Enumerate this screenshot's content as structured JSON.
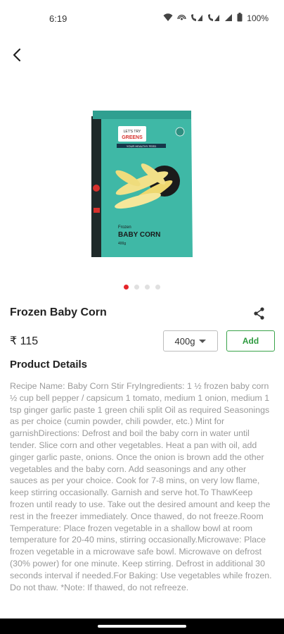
{
  "status_bar": {
    "time": "6:19",
    "battery": "100%"
  },
  "product": {
    "package_brand": "LET'S TRY GREENS",
    "package_tagline": "YOUR HEALTHY FEED",
    "package_label_small": "Frozen",
    "package_label_big": "BABY CORN",
    "package_weight": "400g",
    "title": "Frozen Baby Corn",
    "price": "₹ 115",
    "variant": "400g",
    "add_label": "Add"
  },
  "carousel": {
    "count": 4,
    "active_index": 0
  },
  "details": {
    "heading": "Product Details",
    "description": "Recipe Name: Baby Corn Stir FryIngredients: 1 ½ frozen baby corn ½ cup bell pepper / capsicum 1 tomato, medium 1 onion, medium 1 tsp ginger garlic paste 1 green chili split Oil as required Seasonings as per choice (cumin powder, chili powder, etc.) Mint for garnishDirections: Defrost and boil the baby corn in water until tender. Slice corn and other vegetables. Heat a pan with oil, add ginger garlic paste, onions. Once the onion is brown add the other vegetables and the baby corn. Add seasonings and any other sauces as per your choice. Cook for 7-8 mins, on very low flame, keep stirring occasionally. Garnish and serve hot.To ThawKeep frozen until ready to use. Take out the desired amount and keep the rest in the freezer immediately. Once thawed, do not freeze.Room Temperature: Place frozen vegetable in a shallow bowl at room temperature for 20-40 mins, stirring occasionally.Microwave: Place frozen vegetable in a microwave safe bowl. Microwave on defrost (30% power) for one minute. Keep stirring. Defrost in additional 30 seconds interval if needed.For Baking: Use vegetables while frozen. Do not thaw. *Note: If thawed, do not refreeze."
  },
  "colors": {
    "accent_red": "#e5252a",
    "add_green": "#2e9a3f",
    "package_teal": "#3fb8a6"
  }
}
